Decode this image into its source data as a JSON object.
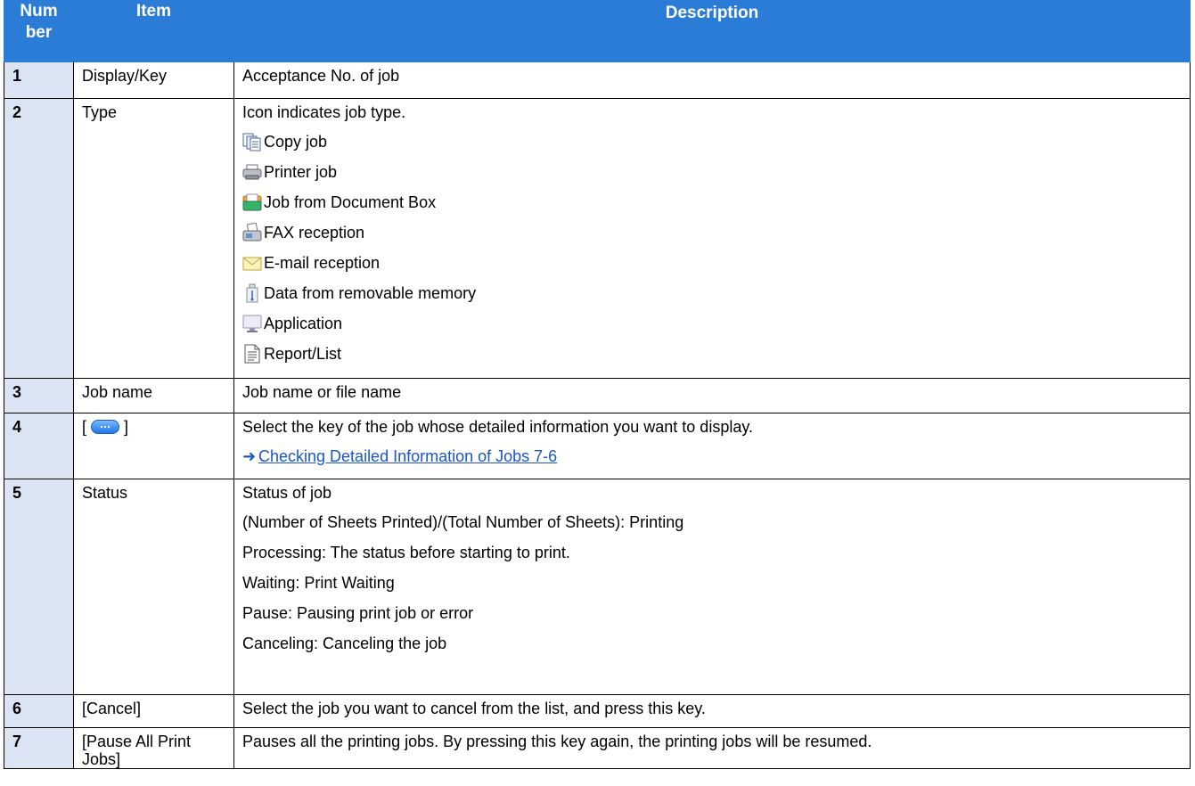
{
  "headers": {
    "number": "Num ber",
    "item": "Item",
    "description": "Description"
  },
  "rows": [
    {
      "number": "1",
      "item": "Display/Key",
      "description": "Acceptance No. of job"
    },
    {
      "number": "2",
      "item": "Type",
      "intro": "Icon indicates job type.",
      "types": [
        {
          "icon": "copy-job-icon",
          "label": "Copy job"
        },
        {
          "icon": "printer-job-icon",
          "label": "Printer job"
        },
        {
          "icon": "document-box-icon",
          "label": "Job from Document Box"
        },
        {
          "icon": "fax-reception-icon",
          "label": "FAX reception"
        },
        {
          "icon": "email-reception-icon",
          "label": "E-mail reception"
        },
        {
          "icon": "removable-memory-icon",
          "label": "Data from removable memory"
        },
        {
          "icon": "application-icon",
          "label": "Application"
        },
        {
          "icon": "report-list-icon",
          "label": "Report/List"
        }
      ]
    },
    {
      "number": "3",
      "item": "Job name",
      "description": "Job name or file name"
    },
    {
      "number": "4",
      "item_prefix": "[",
      "item_suffix": "]",
      "description": "Select the key of the job whose detailed information you want to display.",
      "link": "Checking Detailed Information of Jobs  7-6"
    },
    {
      "number": "5",
      "item": "Status",
      "lines": [
        "Status of job",
        "(Number of Sheets Printed)/(Total Number of Sheets): Printing",
        "Processing: The status before starting to print.",
        "Waiting: Print Waiting",
        "Pause: Pausing print job or error",
        "Canceling: Canceling the job"
      ]
    },
    {
      "number": "6",
      "item": "[Cancel]",
      "description": "Select the job you want to cancel from the list, and press this key."
    },
    {
      "number": "7",
      "item": "[Pause All Print Jobs]",
      "description": "Pauses all the printing jobs. By pressing this key again, the printing jobs will be resumed."
    }
  ],
  "colors": {
    "header_bg": "#2b7cd6",
    "number_bg": "#dae4f3",
    "link": "#1a56c9"
  }
}
